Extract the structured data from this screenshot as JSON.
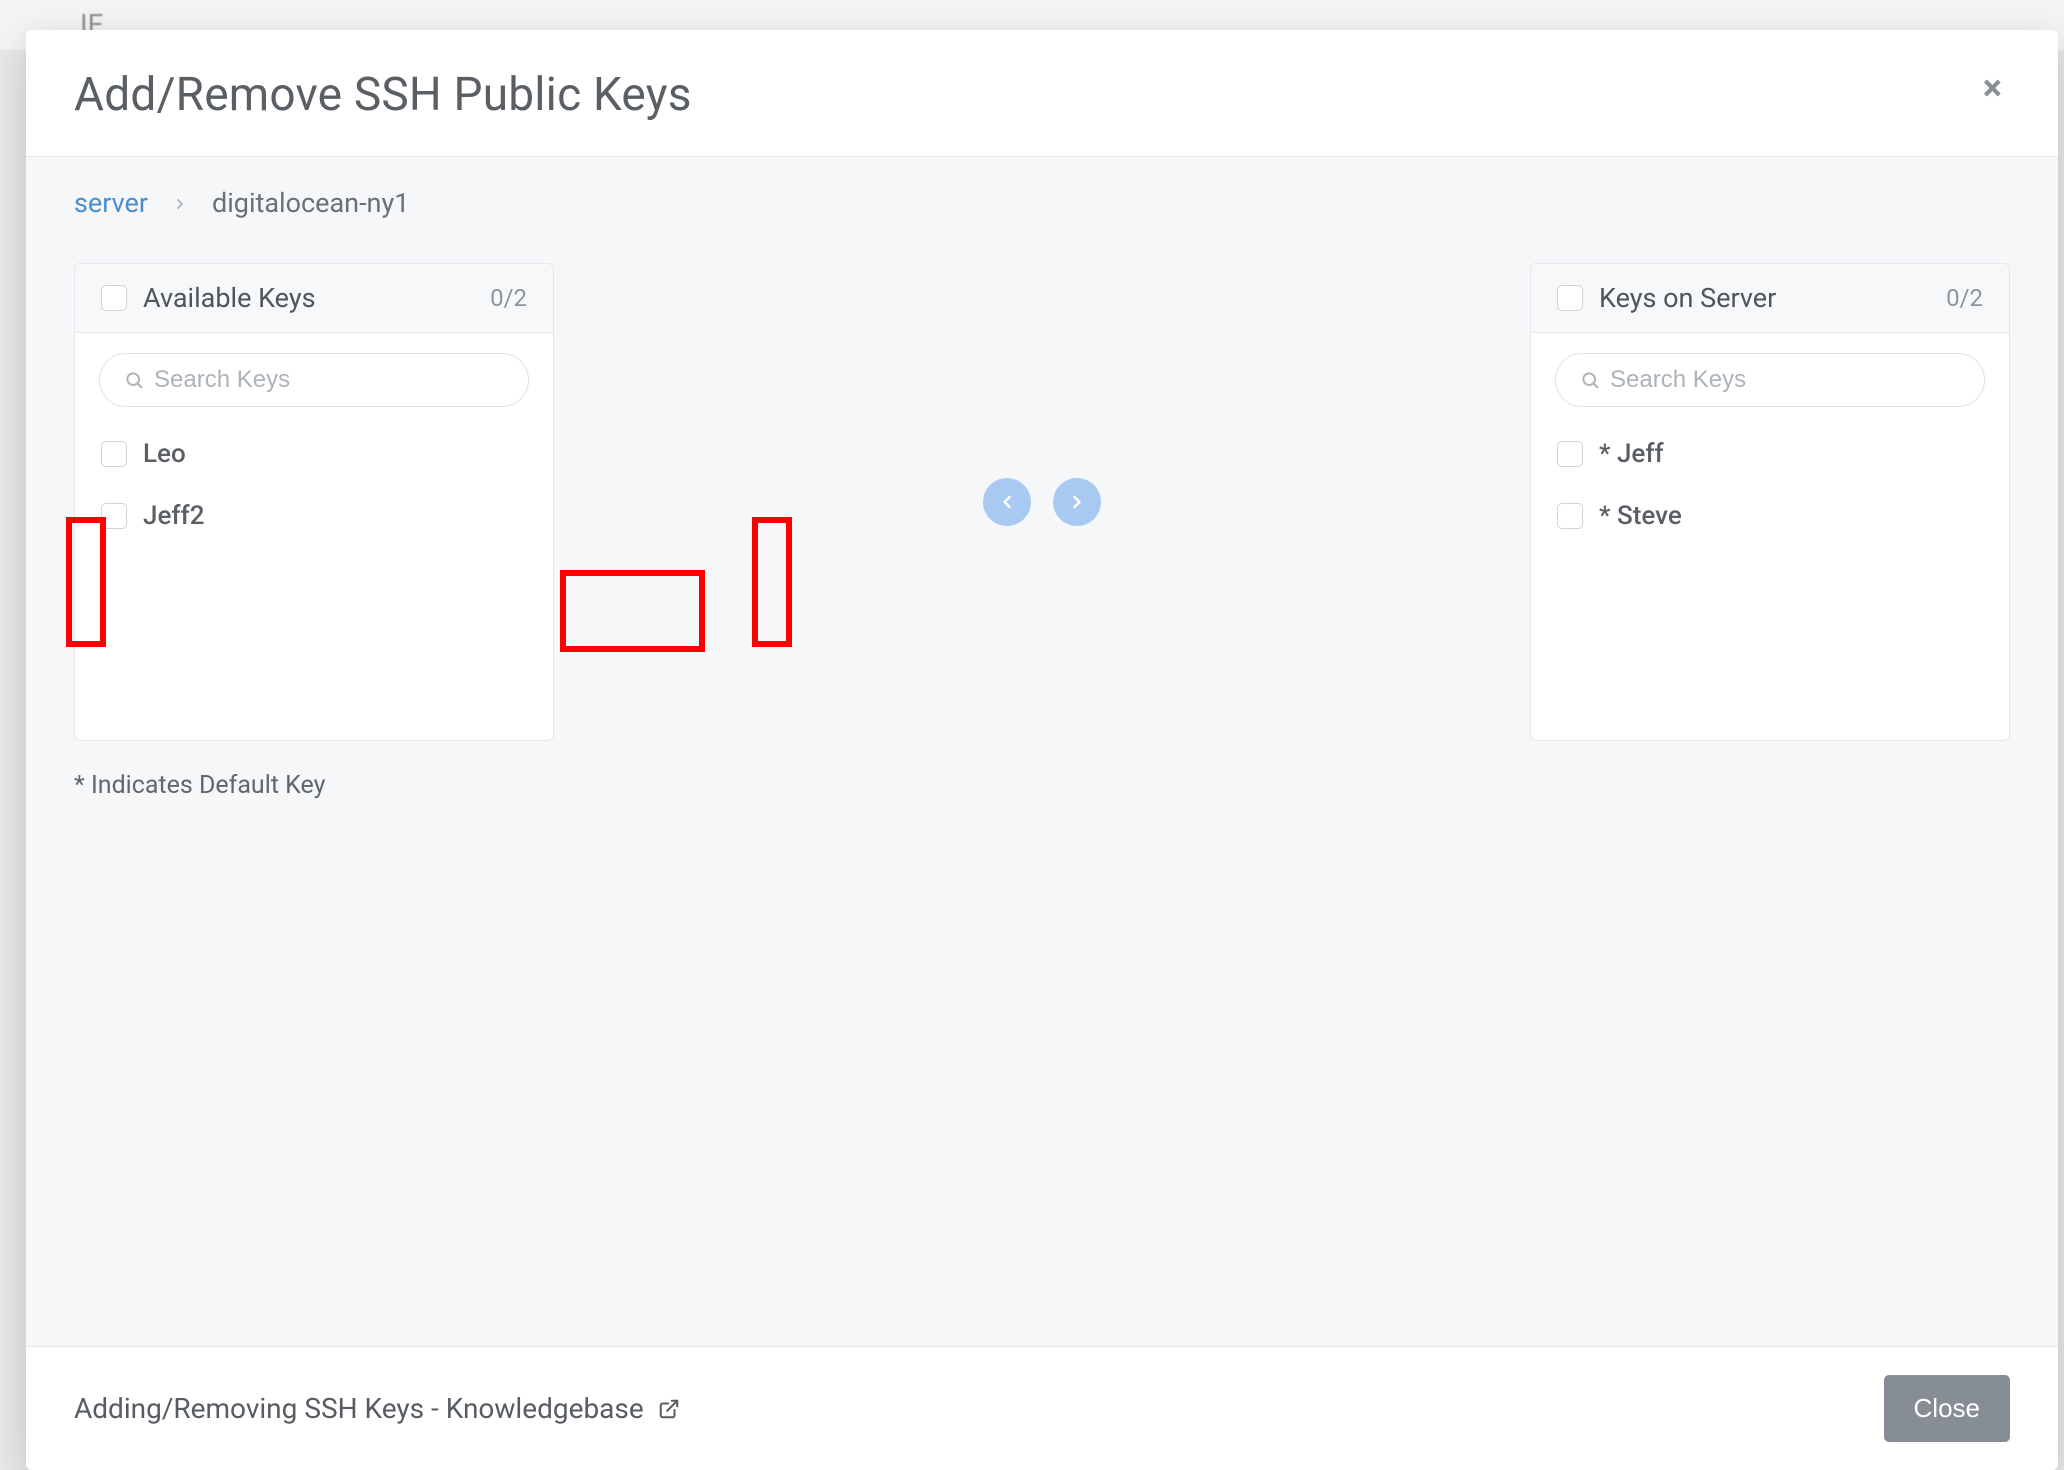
{
  "modal": {
    "title": "Add/Remove SSH Public Keys",
    "close_icon": "×"
  },
  "breadcrumb": {
    "link": "server",
    "separator_icon": "chevron-right",
    "current": "digitalocean-ny1"
  },
  "available_panel": {
    "title": "Available Keys",
    "count": "0/2",
    "search_placeholder": "Search Keys",
    "items": [
      {
        "label": "Leo"
      },
      {
        "label": "Jeff2"
      }
    ]
  },
  "server_panel": {
    "title": "Keys on Server",
    "count": "0/2",
    "search_placeholder": "Search Keys",
    "items": [
      {
        "label": "* Jeff"
      },
      {
        "label": "* Steve"
      }
    ]
  },
  "transfer": {
    "left_icon": "chevron-left",
    "right_icon": "chevron-right"
  },
  "footnote": "* Indicates Default Key",
  "footer": {
    "kb_link": "Adding/Removing SSH Keys - Knowledgebase",
    "close_label": "Close"
  },
  "colors": {
    "link_blue": "#4b8ecb",
    "arrow_blue": "#a8caf2",
    "button_gray": "#878d95",
    "highlight_red": "#ff0000"
  }
}
